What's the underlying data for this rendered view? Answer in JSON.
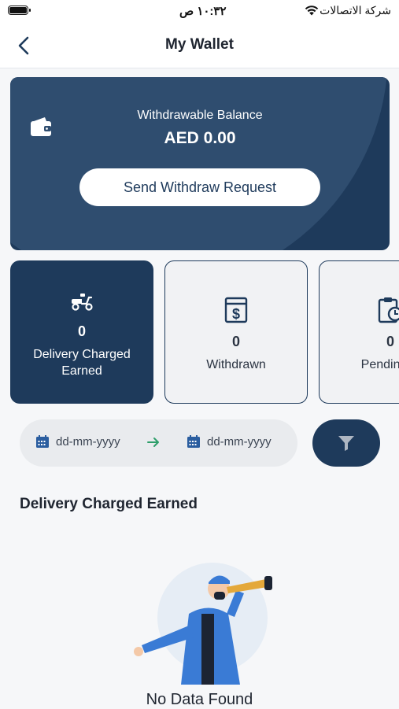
{
  "status_bar": {
    "time": "١٠:٣٢ ص",
    "carrier": "شركة الاتصالات"
  },
  "nav": {
    "title": "My Wallet"
  },
  "balance_card": {
    "label": "Withdrawable Balance",
    "value": "AED 0.00",
    "button_label": "Send Withdraw Request"
  },
  "stats": [
    {
      "value": "0",
      "label_line1": "Delivery Charged",
      "label_line2": "Earned",
      "icon": "scooter-icon",
      "active": true
    },
    {
      "value": "0",
      "label_line1": "Withdrawn",
      "label_line2": "",
      "icon": "receipt-dollar-icon",
      "active": false
    },
    {
      "value": "0",
      "label_line1": "Pending w",
      "label_line2": "",
      "icon": "clipboard-clock-icon",
      "active": false
    }
  ],
  "date_filter": {
    "from_placeholder": "dd-mm-yyyy",
    "to_placeholder": "dd-mm-yyyy"
  },
  "section": {
    "title": "Delivery Charged Earned"
  },
  "empty_state": {
    "text": "No Data Found"
  },
  "colors": {
    "primary": "#1e3a5b",
    "accent_arrow": "#2e9e6a",
    "calendar": "#2a5d9f"
  }
}
